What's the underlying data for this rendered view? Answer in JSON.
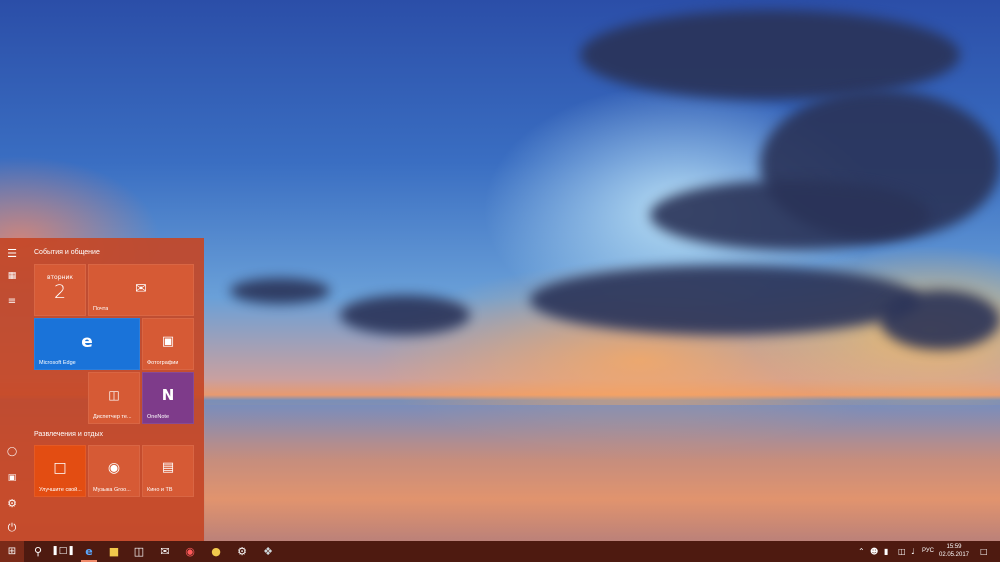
{
  "start_menu": {
    "groups": [
      {
        "title": "События и общение"
      },
      {
        "title": "Развлечения и отдых"
      }
    ],
    "tiles": {
      "calendar_day": "вторник",
      "calendar_date": "2",
      "mail_label": "Почта",
      "edge_label": "Microsoft Edge",
      "photos_label": "Фотографии",
      "device_manager_label": "Диспетчер те...",
      "onenote_label": "OneNote",
      "office_label": "Улучшите свой...",
      "groove_label": "Музыка Groo...",
      "movies_label": "Кино и ТВ"
    },
    "colors": {
      "accent": "#c44626",
      "tile": "#d65a35",
      "edge_tile": "#1a73d9",
      "onenote_tile": "#7e3b8a",
      "office_tile": "#e34d12"
    }
  },
  "taskbar": {
    "language": "РУС",
    "time": "15:59",
    "date": "02.05.2017"
  }
}
